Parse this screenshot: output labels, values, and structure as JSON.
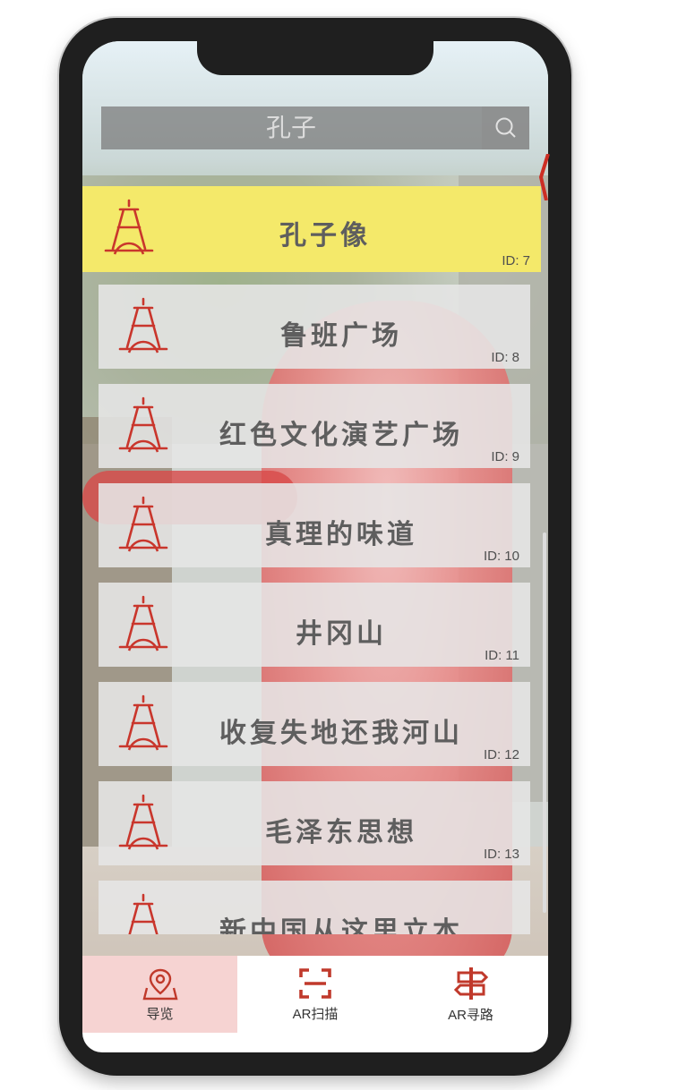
{
  "search": {
    "value": "孔子"
  },
  "places": [
    {
      "name": "孔子像",
      "id": "ID: 7",
      "selected": true
    },
    {
      "name": "鲁班广场",
      "id": "ID: 8"
    },
    {
      "name": "红色文化演艺广场",
      "id": "ID: 9"
    },
    {
      "name": "真理的味道",
      "id": "ID: 10"
    },
    {
      "name": "井冈山",
      "id": "ID: 11"
    },
    {
      "name": "收复失地还我河山",
      "id": "ID: 12"
    },
    {
      "name": "毛泽东思想",
      "id": "ID: 13"
    },
    {
      "name": "新中国从这里立本",
      "id": ""
    }
  ],
  "tabs": [
    {
      "label": "导览",
      "icon": "map-pin-icon",
      "active": true
    },
    {
      "label": "AR扫描",
      "icon": "scan-icon",
      "active": false
    },
    {
      "label": "AR寻路",
      "icon": "signpost-icon",
      "active": false
    }
  ],
  "colors": {
    "selected_card": "#f4e96a",
    "card": "#e6e6e6",
    "accent_red": "#d0342c",
    "active_tab": "#f6d3d2"
  }
}
